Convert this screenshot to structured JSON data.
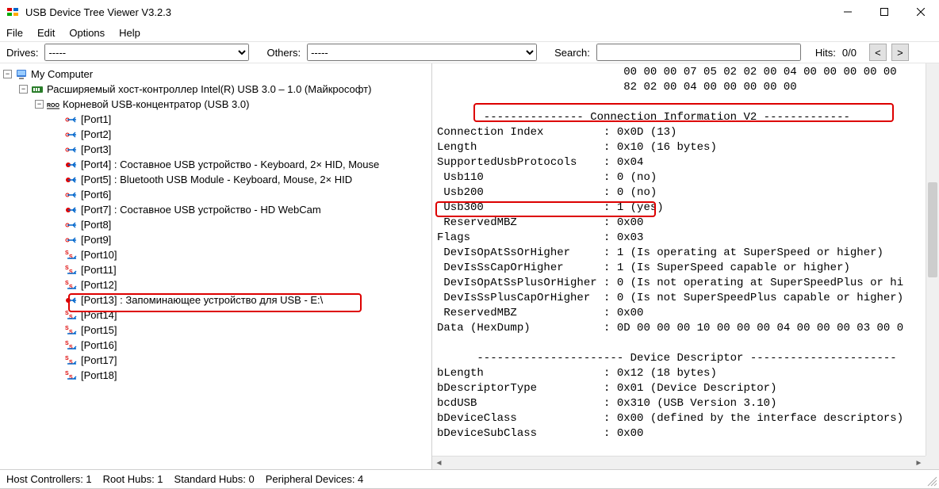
{
  "titlebar": {
    "title": "USB Device Tree Viewer V3.2.3"
  },
  "menubar": {
    "file": "File",
    "edit": "Edit",
    "options": "Options",
    "help": "Help"
  },
  "toolbar": {
    "drives_label": "Drives:",
    "drives_value": "-----",
    "others_label": "Others:",
    "others_value": "-----",
    "search_label": "Search:",
    "search_value": "",
    "hits_label": "Hits:",
    "hits_value": "0/0",
    "prev": "<",
    "next": ">"
  },
  "tree": {
    "root": "My Computer",
    "controller": "Расширяемый хост-контроллер Intel(R) USB 3.0 – 1.0 (Майкрософт)",
    "hub": "Корневой USB-концентратор (USB 3.0)",
    "ports": [
      "[Port1]",
      "[Port2]",
      "[Port3]",
      "[Port4] : Составное USB устройство - Keyboard, 2× HID, Mouse",
      "[Port5] : Bluetooth USB Module - Keyboard, Mouse, 2× HID",
      "[Port6]",
      "[Port7] : Составное USB устройство - HD WebCam",
      "[Port8]",
      "[Port9]",
      "[Port10]",
      "[Port11]",
      "[Port12]",
      "[Port13] : Запоминающее устройство для USB - E:\\",
      "[Port14]",
      "[Port15]",
      "[Port16]",
      "[Port17]",
      "[Port18]"
    ]
  },
  "info_lines": [
    "                            00 00 00 07 05 02 02 00 04 00 00 00 00 00",
    "                            82 02 00 04 00 00 00 00 00",
    "",
    "       --------------- Connection Information V2 -------------",
    "Connection Index         : 0x0D (13)",
    "Length                   : 0x10 (16 bytes)",
    "SupportedUsbProtocols    : 0x04",
    " Usb110                  : 0 (no)",
    " Usb200                  : 0 (no)",
    " Usb300                  : 1 (yes)",
    " ReservedMBZ             : 0x00",
    "Flags                    : 0x03",
    " DevIsOpAtSsOrHigher     : 1 (Is operating at SuperSpeed or higher)",
    " DevIsSsCapOrHigher      : 1 (Is SuperSpeed capable or higher)",
    " DevIsOpAtSsPlusOrHigher : 0 (Is not operating at SuperSpeedPlus or hi",
    " DevIsSsPlusCapOrHigher  : 0 (Is not SuperSpeedPlus capable or higher)",
    " ReservedMBZ             : 0x00",
    "Data (HexDump)           : 0D 00 00 00 10 00 00 00 04 00 00 00 03 00 0",
    "",
    "      ---------------------- Device Descriptor ----------------------",
    "bLength                  : 0x12 (18 bytes)",
    "bDescriptorType          : 0x01 (Device Descriptor)",
    "bcdUSB                   : 0x310 (USB Version 3.10)",
    "bDeviceClass             : 0x00 (defined by the interface descriptors)",
    "bDeviceSubClass          : 0x00"
  ],
  "statusbar": {
    "host": "Host Controllers: 1",
    "roothubs": "Root Hubs: 1",
    "stdhubs": "Standard Hubs: 0",
    "periph": "Peripheral Devices: 4"
  }
}
